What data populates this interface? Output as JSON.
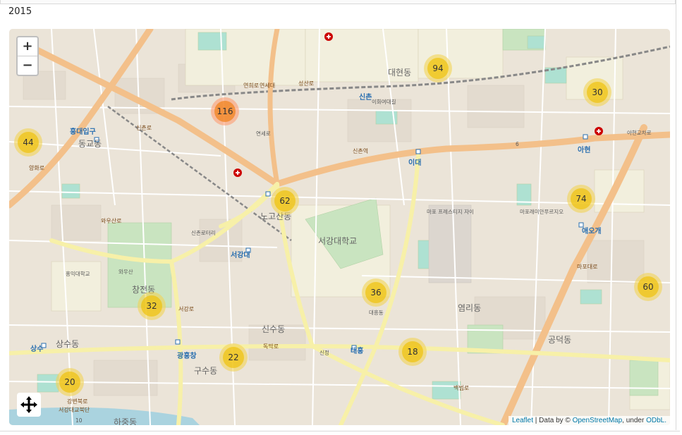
{
  "header": {
    "year": "2015"
  },
  "map": {
    "zoom_in_label": "+",
    "zoom_out_label": "−",
    "clusters": [
      {
        "count": "116",
        "size": "large"
      },
      {
        "count": "94",
        "size": "medium"
      },
      {
        "count": "30",
        "size": "medium"
      },
      {
        "count": "44",
        "size": "medium"
      },
      {
        "count": "62",
        "size": "medium"
      },
      {
        "count": "74",
        "size": "medium"
      },
      {
        "count": "36",
        "size": "medium"
      },
      {
        "count": "60",
        "size": "medium"
      },
      {
        "count": "32",
        "size": "medium"
      },
      {
        "count": "18",
        "size": "medium"
      },
      {
        "count": "22",
        "size": "medium"
      },
      {
        "count": "20",
        "size": "medium"
      }
    ],
    "labels": {
      "hongik_station": "홍대입구",
      "donggyo": "동교동",
      "sinchon": "신촌",
      "sinchon_station": "신촌역",
      "ewha": "이대",
      "ewha_univ": "이화여대길",
      "ahyeon": "아현",
      "daehyeon": "대현동",
      "nogosan": "노고산동",
      "sogang_univ": "서강대학교",
      "sogang": "서강대",
      "changjeon": "창전동",
      "sinsu": "신수동",
      "yeomni": "염리동",
      "gongdeok": "공덕동",
      "aeogae": "애오개",
      "sangsu": "상수",
      "sangsu_dong": "상수동",
      "gwangheungchang": "광흥창",
      "daeheung": "대흥",
      "gusu": "구수동",
      "hajung": "하중동",
      "wausan": "와우산",
      "hongik_univ": "홍익대학교",
      "yeonhui": "연희로",
      "sinchon_ro": "신촌로",
      "seongsan_ro": "성산로",
      "yanghwa_ro": "양화로",
      "mapo_ro": "마포대로",
      "baekbeom_ro": "백범로",
      "dokmak_ro": "독막로",
      "seogang_ro": "서강로",
      "wausan_ro": "와우산로",
      "gangbyeon": "강변북로",
      "seogang_bridge": "서강대교북단",
      "sinchon_rotary": "신촌로터리",
      "mapo_prestige": "마포 프레스티지 자이",
      "mapo_raemian": "마포래미안푸르지오",
      "ahyeon_junction": "아현교차로",
      "yeonse": "연세로",
      "yeonse_ro": "연세대",
      "daeheung_dong": "대흥동",
      "sinjeong": "신정",
      "route_6": "6",
      "route_10": "10"
    },
    "attribution": {
      "leaflet": "Leaflet",
      "sep": " | Data by © ",
      "osm": "OpenStreetMap",
      "under": ", under ",
      "odbl": "ODbL."
    }
  }
}
